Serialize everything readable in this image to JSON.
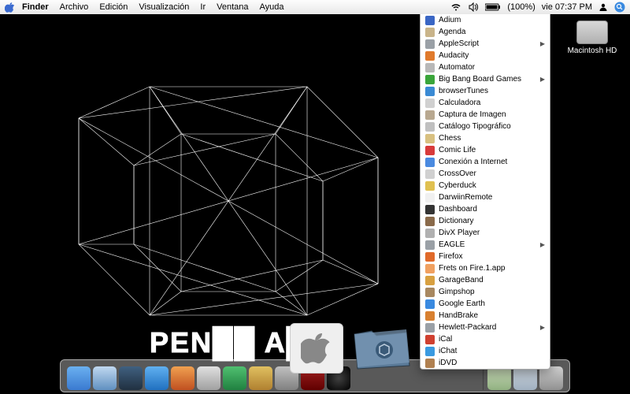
{
  "menubar": {
    "app": "Finder",
    "items": [
      "Archivo",
      "Edición",
      "Visualización",
      "Ir",
      "Ventana",
      "Ayuda"
    ],
    "battery": "(100%)",
    "clock": "vie 07:37 PM"
  },
  "desktop": {
    "hd_label": "Macintosh HD"
  },
  "popup": {
    "items": [
      {
        "label": "Adium",
        "color": "#3a66c4",
        "submenu": false
      },
      {
        "label": "Agenda",
        "color": "#c9b48a",
        "submenu": false
      },
      {
        "label": "AppleScript",
        "color": "#9aa0a6",
        "submenu": true
      },
      {
        "label": "Audacity",
        "color": "#e07a2c",
        "submenu": false
      },
      {
        "label": "Automator",
        "color": "#b8b8b8",
        "submenu": false
      },
      {
        "label": "Big Bang Board Games",
        "color": "#3aa53a",
        "submenu": true
      },
      {
        "label": "browserTunes",
        "color": "#3a8ad4",
        "submenu": false
      },
      {
        "label": "Calculadora",
        "color": "#d0d0d0",
        "submenu": false
      },
      {
        "label": "Captura de Imagen",
        "color": "#b8a890",
        "submenu": false
      },
      {
        "label": "Catálogo Tipográfico",
        "color": "#c0c0c0",
        "submenu": false
      },
      {
        "label": "Chess",
        "color": "#d8c080",
        "submenu": false
      },
      {
        "label": "Comic Life",
        "color": "#d83a3a",
        "submenu": false
      },
      {
        "label": "Conexión a Internet",
        "color": "#4a8ae0",
        "submenu": false
      },
      {
        "label": "CrossOver",
        "color": "#d0d0d0",
        "submenu": false
      },
      {
        "label": "Cyberduck",
        "color": "#e0c050",
        "submenu": false
      },
      {
        "label": "DarwiinRemote",
        "color": "#f0f0f0",
        "submenu": false
      },
      {
        "label": "Dashboard",
        "color": "#333333",
        "submenu": false
      },
      {
        "label": "Dictionary",
        "color": "#8a6a4a",
        "submenu": false
      },
      {
        "label": "DivX Player",
        "color": "#b0b0b0",
        "submenu": false
      },
      {
        "label": "EAGLE",
        "color": "#9aa0a6",
        "submenu": true
      },
      {
        "label": "Firefox",
        "color": "#e06a2a",
        "submenu": false
      },
      {
        "label": "Frets on Fire.1.app",
        "color": "#f0a060",
        "submenu": false
      },
      {
        "label": "GarageBand",
        "color": "#d8a040",
        "submenu": false
      },
      {
        "label": "Gimpshop",
        "color": "#a88860",
        "submenu": false
      },
      {
        "label": "Google Earth",
        "color": "#3a8ae0",
        "submenu": false
      },
      {
        "label": "HandBrake",
        "color": "#d88030",
        "submenu": false
      },
      {
        "label": "Hewlett-Packard",
        "color": "#9aa0a6",
        "submenu": true
      },
      {
        "label": "iCal",
        "color": "#d04030",
        "submenu": false
      },
      {
        "label": "iChat",
        "color": "#3a9ae0",
        "submenu": false
      },
      {
        "label": "iDVD",
        "color": "#b08050",
        "submenu": false
      }
    ]
  },
  "dock": {
    "items": [
      {
        "name": "finder",
        "bg": "linear-gradient(#6ab0f0,#3a7ad0)"
      },
      {
        "name": "safari",
        "bg": "linear-gradient(#c0d8f0,#6090c0)"
      },
      {
        "name": "google-earth",
        "bg": "linear-gradient(#406080,#203040)"
      },
      {
        "name": "ichat",
        "bg": "linear-gradient(#60b0f0,#2070c0)"
      },
      {
        "name": "firefox",
        "bg": "linear-gradient(#f0a050,#c05020)"
      },
      {
        "name": "mail",
        "bg": "linear-gradient(#e0e0e0,#a0a0a0)"
      },
      {
        "name": "itunes",
        "bg": "linear-gradient(#50c070,#208040)"
      },
      {
        "name": "iphoto",
        "bg": "linear-gradient(#e0c060,#b08030)"
      },
      {
        "name": "system-prefs",
        "bg": "linear-gradient(#c0c0c0,#808080)"
      },
      {
        "name": "photo-booth",
        "bg": "linear-gradient(#a02020,#600000)"
      },
      {
        "name": "dashboard",
        "bg": "radial-gradient(#404040,#000)"
      }
    ],
    "right_items": [
      {
        "name": "desktop-stack",
        "bg": "linear-gradient(#d0e0c0,#90b080)"
      },
      {
        "name": "documents-stack",
        "bg": "linear-gradient(#d0d8e0,#a0b0c0)"
      },
      {
        "name": "trash",
        "bg": "linear-gradient(#d0d0d0,#909090)"
      }
    ]
  }
}
